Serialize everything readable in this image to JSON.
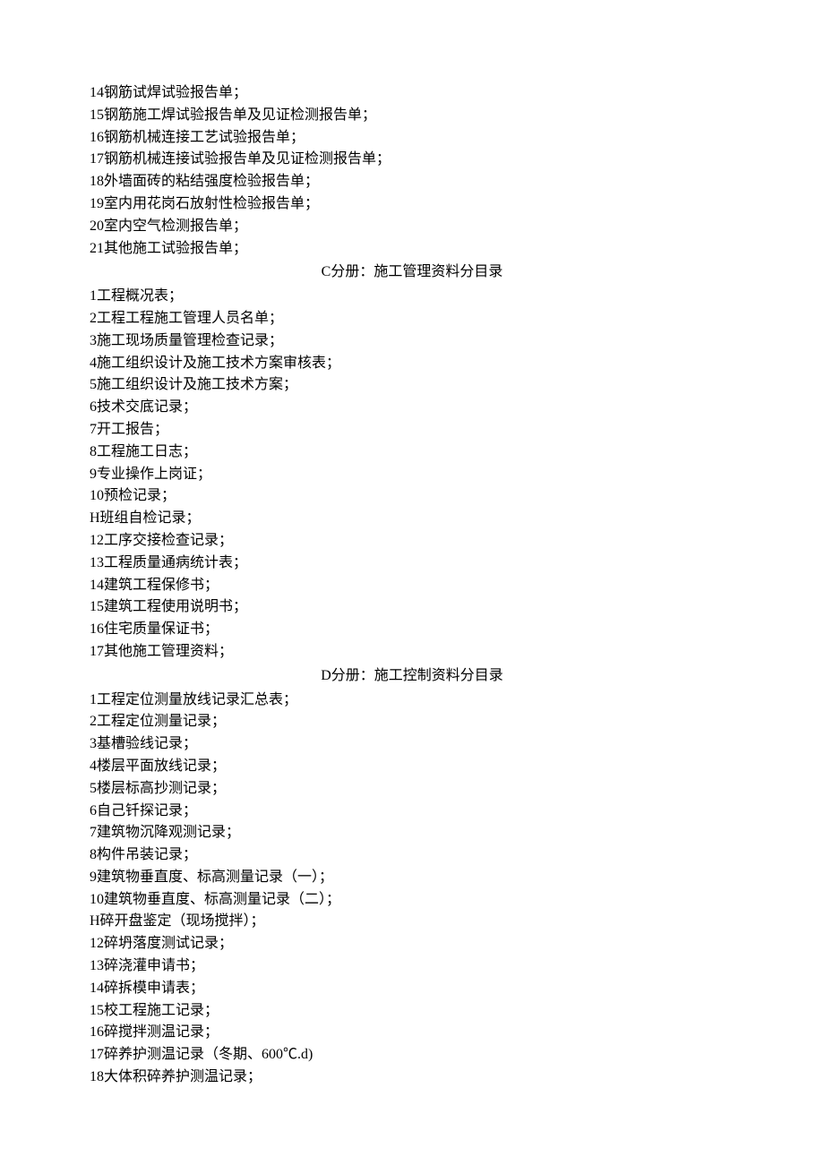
{
  "block1": {
    "items": [
      "14钢筋试焊试验报告单；",
      "15钢筋施工焊试验报告单及见证检测报告单；",
      "16钢筋机械连接工艺试验报告单；",
      "17钢筋机械连接试验报告单及见证检测报告单；",
      "18外墙面砖的粘结强度检验报告单；",
      "19室内用花岗石放射性检验报告单；",
      "20室内空气检测报告单；",
      "21其他施工试验报告单；"
    ]
  },
  "sectionC": {
    "title": "C分册：施工管理资料分目录",
    "items": [
      "1工程概况表；",
      "2工程工程施工管理人员名单；",
      "3施工现场质量管理检查记录；",
      "4施工组织设计及施工技术方案审核表；",
      "5施工组织设计及施工技术方案；",
      "6技术交底记录；",
      "7开工报告；",
      "8工程施工日志；",
      "9专业操作上岗证；",
      "10预检记录；",
      "H班组自检记录；",
      "12工序交接检查记录；",
      "13工程质量通病统计表；",
      "14建筑工程保修书；",
      "15建筑工程使用说明书；",
      "16住宅质量保证书；",
      "17其他施工管理资料；"
    ]
  },
  "sectionD": {
    "title": "D分册：施工控制资料分目录",
    "items": [
      "1工程定位测量放线记录汇总表；",
      "2工程定位测量记录；",
      "3基槽验线记录；",
      "4楼层平面放线记录；",
      "5楼层标高抄测记录；",
      "6自己钎探记录；",
      "7建筑物沉降观测记录；",
      "8构件吊装记录；",
      "9建筑物垂直度、标高测量记录（一）；",
      "10建筑物垂直度、标高测量记录（二）；",
      "H碎开盘鉴定（现场搅拌）；",
      "12碎坍落度测试记录；",
      "13碎浇灌申请书；",
      "14碎拆模申请表；",
      "15校工程施工记录；",
      "16碎搅拌测温记录；",
      "17碎养护测温记录（冬期、600℃.d)",
      "18大体积碎养护测温记录；"
    ]
  }
}
